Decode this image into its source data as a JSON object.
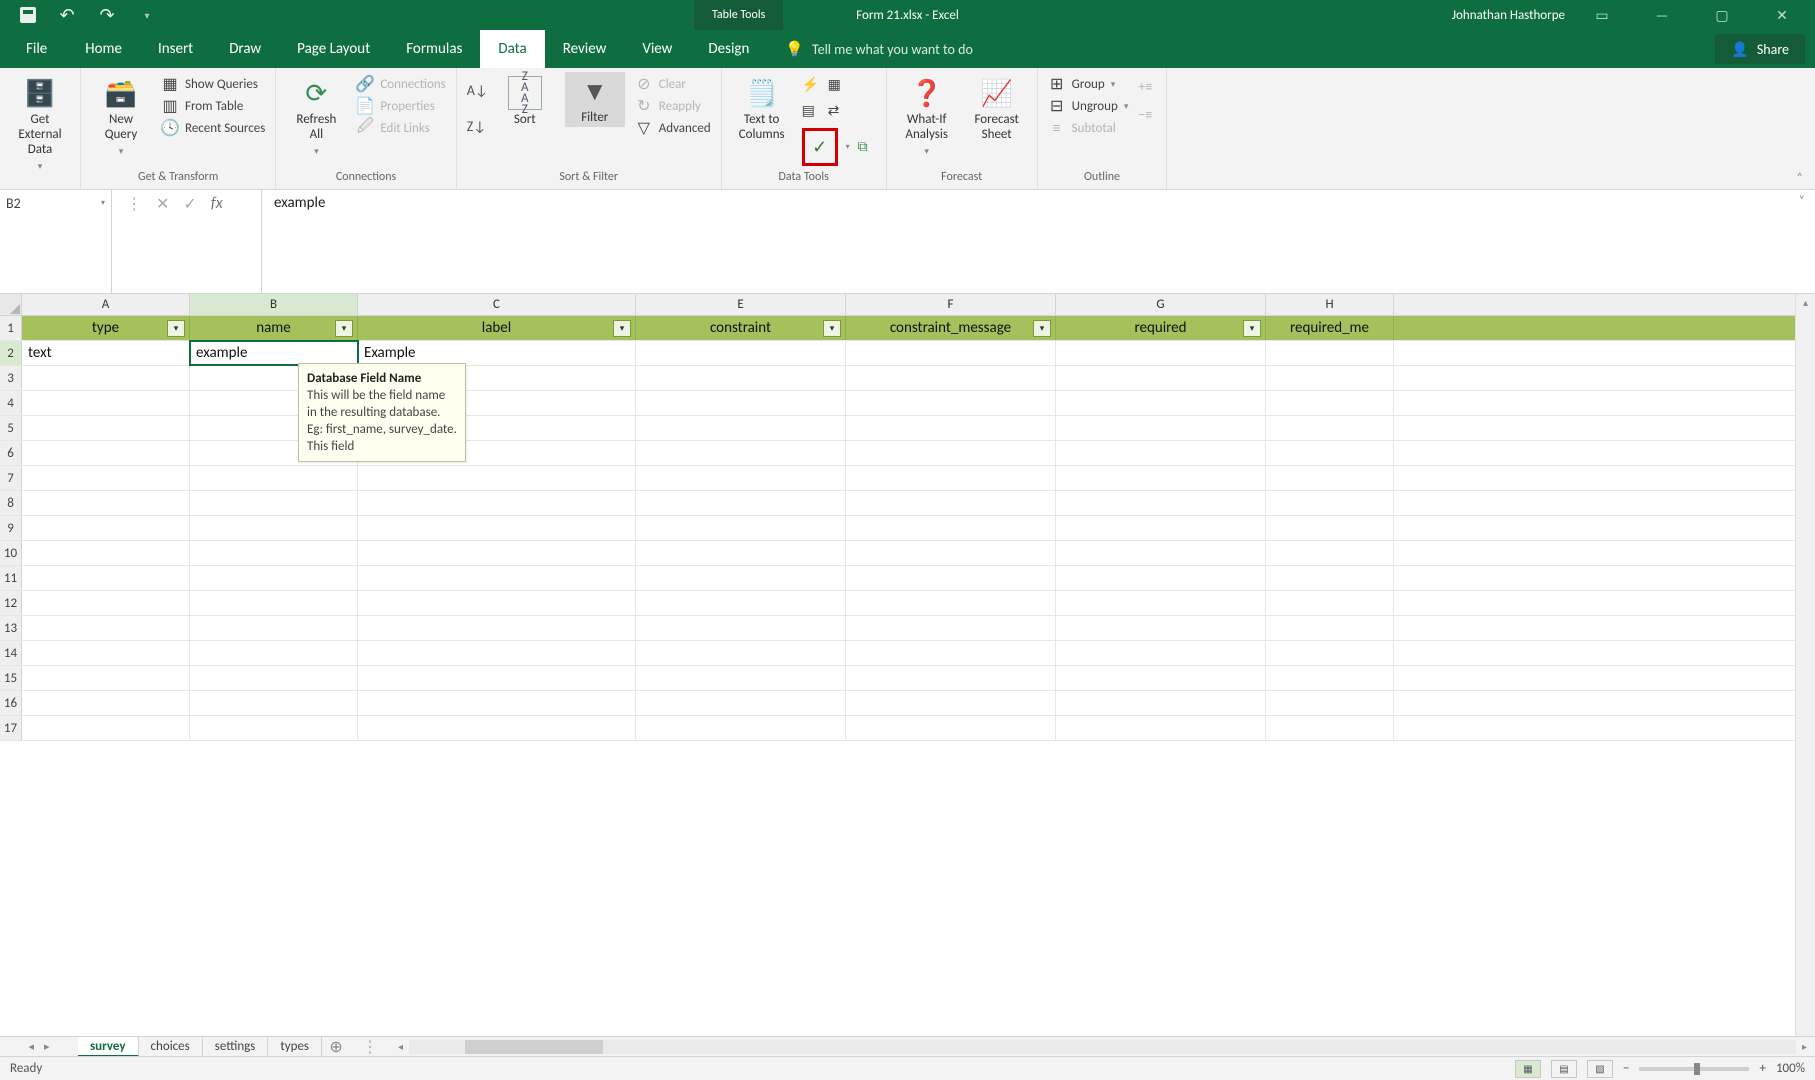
{
  "titlebar": {
    "title": "Form 21.xlsx - Excel",
    "tabletools": "Table Tools",
    "username": "Johnathan Hasthorpe"
  },
  "tabs": {
    "file": "File",
    "home": "Home",
    "insert": "Insert",
    "draw": "Draw",
    "pagelayout": "Page Layout",
    "formulas": "Formulas",
    "data": "Data",
    "review": "Review",
    "view": "View",
    "design": "Design",
    "tellme": "Tell me what you want to do",
    "share": "Share"
  },
  "ribbon": {
    "get_external": "Get External\nData",
    "new_query": "New\nQuery",
    "show_queries": "Show Queries",
    "from_table": "From Table",
    "recent_sources": "Recent Sources",
    "grp_get_transform": "Get & Transform",
    "refresh_all": "Refresh\nAll",
    "connections": "Connections",
    "properties": "Properties",
    "edit_links": "Edit Links",
    "grp_connections": "Connections",
    "sort": "Sort",
    "filter": "Filter",
    "clear": "Clear",
    "reapply": "Reapply",
    "advanced": "Advanced",
    "grp_sort_filter": "Sort & Filter",
    "text_to_columns": "Text to\nColumns",
    "grp_data_tools": "Data Tools",
    "whatif": "What-If\nAnalysis",
    "forecast_sheet": "Forecast\nSheet",
    "grp_forecast": "Forecast",
    "group": "Group",
    "ungroup": "Ungroup",
    "subtotal": "Subtotal",
    "grp_outline": "Outline"
  },
  "formula": {
    "namebox": "B2",
    "value": "example"
  },
  "columns": [
    "A",
    "B",
    "C",
    "E",
    "F",
    "G",
    "H"
  ],
  "headers": {
    "A": "type",
    "B": "name",
    "C": "label",
    "E": "constraint",
    "F": "constraint_message",
    "G": "required",
    "H": "required_me"
  },
  "row2": {
    "A": "text",
    "B": "example",
    "C": "Example"
  },
  "tooltip": {
    "title": "Database Field Name",
    "body": "This will be the field name in the resulting database. Eg: first_name, survey_date. This field"
  },
  "sheet_tabs": [
    "survey",
    "choices",
    "settings",
    "types"
  ],
  "status": {
    "ready": "Ready",
    "zoom": "100%"
  }
}
